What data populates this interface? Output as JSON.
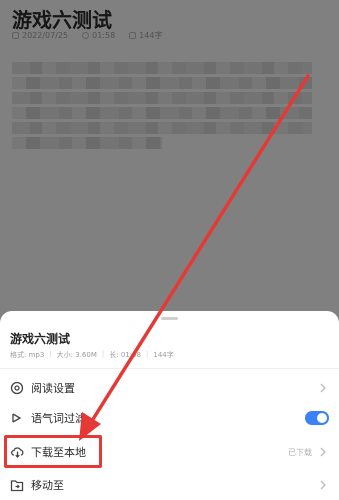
{
  "page": {
    "title": "游戏六测试",
    "date": "2022/07/25",
    "duration": "01:58",
    "chars": "144字"
  },
  "sheet": {
    "title": "游戏六测试",
    "format_label": "格式: mp3",
    "size_label": "大小: 3.60M",
    "duration_label": "长: 01:58",
    "chars": "144字"
  },
  "menu": {
    "read_settings": "阅读设置",
    "filler_filter": "语气词过滤",
    "download": "下载至本地",
    "download_status": "已下载",
    "move_to": "移动至"
  },
  "colors": {
    "accent": "#3b82f6",
    "highlight": "#e53935"
  }
}
